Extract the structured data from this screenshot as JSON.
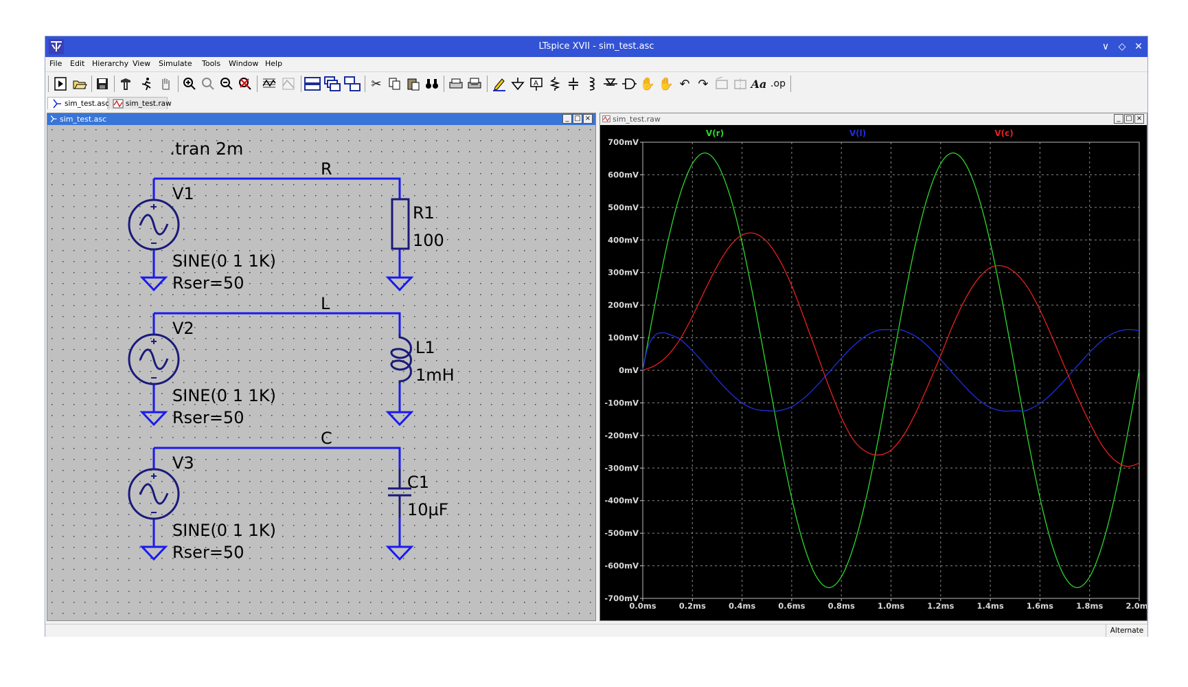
{
  "window": {
    "title": "LTspice XVII - sim_test.asc",
    "minimize": "∨",
    "restore": "◇",
    "close": "✕"
  },
  "menu": [
    "File",
    "Edit",
    "Hierarchy",
    "View",
    "Simulate",
    "Tools",
    "Window",
    "Help"
  ],
  "toolbar": {
    "tools": [
      "new-schematic",
      "open",
      "save",
      "control-panel",
      "run",
      "halt",
      "zoom-in",
      "pan",
      "zoom-out",
      "zoom-full",
      "autorange",
      "delete-waveform",
      "tile-horizontal",
      "cascade",
      "tile-vertical",
      "cut",
      "copy",
      "paste",
      "find",
      "print-setup",
      "print",
      "draw-wire",
      "ground",
      "label-net",
      "resistor",
      "capacitor",
      "inductor",
      "diode",
      "component",
      "move",
      "drag",
      "undo",
      "redo",
      "rotate",
      "mirror",
      "text",
      "spice-directive"
    ],
    "text_font_label": "Aa",
    "op_label": ".op"
  },
  "tabs": [
    {
      "label": "sim_test.asc",
      "active": true
    },
    {
      "label": "sim_test.raw",
      "active": false
    }
  ],
  "schematic": {
    "window_title": "sim_test.asc",
    "directive": ".tran 2m",
    "circuits": [
      {
        "net": "R",
        "source": "V1",
        "sine": "SINE(0 1 1K)",
        "rser": "Rser=50",
        "comp": "R1",
        "value": "100",
        "kind": "resistor"
      },
      {
        "net": "L",
        "source": "V2",
        "sine": "SINE(0 1 1K)",
        "rser": "Rser=50",
        "comp": "L1",
        "value": "1mH",
        "kind": "inductor"
      },
      {
        "net": "C",
        "source": "V3",
        "sine": "SINE(0 1 1K)",
        "rser": "Rser=50",
        "comp": "C1",
        "value": "10µF",
        "kind": "capacitor"
      }
    ]
  },
  "plot": {
    "window_title": "sim_test.raw",
    "background": "#000000",
    "grid": true
  },
  "chart_data": {
    "type": "line",
    "xlim": [
      0,
      2.0
    ],
    "ylim": [
      -700,
      700
    ],
    "xticks": [
      "0.0ms",
      "0.2ms",
      "0.4ms",
      "0.6ms",
      "0.8ms",
      "1.0ms",
      "1.2ms",
      "1.4ms",
      "1.6ms",
      "1.8ms",
      "2.0ms"
    ],
    "yticks": [
      "700mV",
      "600mV",
      "500mV",
      "400mV",
      "300mV",
      "200mV",
      "100mV",
      "0mV",
      "-100mV",
      "-200mV",
      "-300mV",
      "-400mV",
      "-500mV",
      "-600mV",
      "-700mV"
    ],
    "series": [
      {
        "name": "V(r)",
        "color": "#2fd72f",
        "x": [
          0,
          0.05,
          0.1,
          0.15,
          0.2,
          0.25,
          0.3,
          0.35,
          0.4,
          0.45,
          0.5,
          0.55,
          0.6,
          0.65,
          0.7,
          0.75,
          0.8,
          0.85,
          0.9,
          0.95,
          1.0,
          1.05,
          1.1,
          1.15,
          1.2,
          1.25,
          1.3,
          1.35,
          1.4,
          1.45,
          1.5,
          1.55,
          1.6,
          1.65,
          1.7,
          1.75,
          1.8,
          1.85,
          1.9,
          1.95,
          2.0
        ],
        "y": [
          0,
          206,
          392,
          539,
          634,
          667,
          634,
          539,
          392,
          206,
          0,
          -206,
          -392,
          -539,
          -634,
          -667,
          -634,
          -539,
          -392,
          -206,
          0,
          206,
          392,
          539,
          634,
          667,
          634,
          539,
          392,
          206,
          0,
          -206,
          -392,
          -539,
          -634,
          -667,
          -634,
          -539,
          -392,
          -206,
          0
        ]
      },
      {
        "name": "V(l)",
        "color": "#1f2fe0",
        "x": [
          0,
          0.02,
          0.05,
          0.08,
          0.1,
          0.15,
          0.2,
          0.25,
          0.3,
          0.35,
          0.4,
          0.45,
          0.5,
          0.53,
          0.55,
          0.6,
          0.65,
          0.7,
          0.75,
          0.8,
          0.85,
          0.9,
          0.95,
          1.0,
          1.03,
          1.05,
          1.1,
          1.15,
          1.2,
          1.25,
          1.3,
          1.35,
          1.4,
          1.45,
          1.5,
          1.53,
          1.55,
          1.6,
          1.65,
          1.7,
          1.75,
          1.8,
          1.85,
          1.9,
          1.95,
          2.0
        ],
        "y": [
          0,
          70,
          108,
          115,
          112,
          95,
          60,
          18,
          -27,
          -68,
          -100,
          -119,
          -124,
          -125,
          -124,
          -112,
          -85,
          -48,
          -6,
          37,
          76,
          106,
          123,
          125,
          125,
          122,
          104,
          73,
          33,
          -10,
          -52,
          -89,
          -114,
          -125,
          -124,
          -125,
          -122,
          -102,
          -70,
          -30,
          13,
          55,
          91,
          115,
          125,
          122
        ]
      },
      {
        "name": "V(c)",
        "color": "#e82020",
        "x": [
          0,
          0.05,
          0.1,
          0.15,
          0.2,
          0.25,
          0.3,
          0.35,
          0.4,
          0.45,
          0.5,
          0.55,
          0.6,
          0.65,
          0.7,
          0.75,
          0.8,
          0.85,
          0.9,
          0.95,
          1.0,
          1.05,
          1.1,
          1.15,
          1.2,
          1.25,
          1.3,
          1.35,
          1.4,
          1.45,
          1.5,
          1.55,
          1.6,
          1.65,
          1.7,
          1.75,
          1.8,
          1.85,
          1.9,
          1.95,
          2.0
        ],
        "y": [
          0,
          15,
          45,
          95,
          165,
          245,
          320,
          380,
          415,
          420,
          395,
          340,
          260,
          160,
          55,
          -50,
          -145,
          -215,
          -250,
          -260,
          -245,
          -200,
          -130,
          -45,
          45,
          140,
          220,
          280,
          315,
          320,
          300,
          255,
          185,
          100,
          10,
          -80,
          -160,
          -230,
          -275,
          -295,
          -285
        ]
      }
    ]
  }
}
